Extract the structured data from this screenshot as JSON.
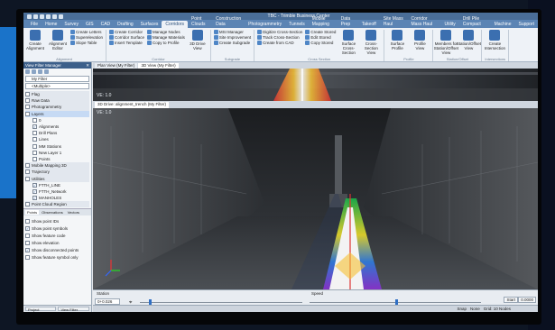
{
  "app": {
    "title": "TBC - Trimble Business Center",
    "menu_tabs": [
      "File",
      "Home",
      "Survey",
      "GIS",
      "CAD",
      "Drafting",
      "Surfaces",
      "Corridors",
      "Point Clouds",
      "Construction Data",
      "Photogrammetry",
      "Tunnels",
      "Mobile Mapping",
      "Data Prep",
      "Takeoff",
      "Site Mass Haul",
      "Corridor Mass Haul",
      "Utility",
      "Drill Pile Compact",
      "Machine",
      "Support"
    ],
    "active_tab": "Corridors"
  },
  "ribbon": {
    "groups": [
      {
        "label": "Alignment",
        "big": [
          "Create Alignment",
          "Alignment Editor"
        ],
        "small": [
          "Create Letters",
          "Superelevation",
          "Slope Table"
        ]
      },
      {
        "label": "Corridor",
        "small": [
          "Create Corridor",
          "Corridor Surface",
          "Insert Template"
        ],
        "small2": [
          "Manage Nodes",
          "Manage Materials",
          "Copy to Profile"
        ],
        "big": [
          "3D Drive View"
        ]
      },
      {
        "label": "Subgrade",
        "small": [
          "MSI Manager",
          "Site Improvement",
          "Create Subgrade"
        ]
      },
      {
        "label": "Cross Section",
        "big": [
          "Surface Cross-Section",
          "Cross-Section View"
        ],
        "small": [
          "Digitize Cross-Section",
          "Track Cross-Section",
          "Create from CAD"
        ],
        "small2": [
          "Create Stored",
          "Edit Stored",
          "Copy Stored"
        ]
      },
      {
        "label": "Profile",
        "big": [
          "Surface Profile",
          "Profile View"
        ]
      },
      {
        "label": "Station/Offset",
        "big": [
          "Members for Station/Offset View",
          "Station/Offset View"
        ]
      },
      {
        "label": "Intersections",
        "big": [
          "Create Intersection"
        ]
      }
    ]
  },
  "left_panel": {
    "title": "View Filter Manager",
    "filter_name": "My Filter",
    "filter_sub": "<Multiple>",
    "groups": [
      {
        "label": "Flag",
        "checked": false
      },
      {
        "label": "Raw Data",
        "checked": false
      },
      {
        "label": "Photogrammetry",
        "checked": false
      }
    ],
    "layers_label": "Layers",
    "layers": [
      {
        "label": "0",
        "checked": false
      },
      {
        "label": "Alignments",
        "checked": true
      },
      {
        "label": "Drill Plans",
        "checked": false
      },
      {
        "label": "Lines",
        "checked": false
      },
      {
        "label": "MM Stations",
        "checked": false
      },
      {
        "label": "New Layer 1",
        "checked": false
      },
      {
        "label": "Points",
        "checked": false
      }
    ],
    "more_groups": [
      {
        "label": "Mobile Mapping 3D",
        "checked": false
      },
      {
        "label": "Trajectory",
        "checked": false
      },
      {
        "label": "Utilities",
        "checked": false
      }
    ],
    "utilities": [
      {
        "label": "FTTH_LINE",
        "checked": true
      },
      {
        "label": "FTTH_Network",
        "checked": true
      },
      {
        "label": "MANHOLES",
        "checked": true
      }
    ],
    "point_cloud_label": "Point Cloud Region",
    "prop_tabs": [
      "Points",
      "Observations",
      "Vectors"
    ],
    "options": [
      {
        "label": "Show point IDs",
        "checked": false
      },
      {
        "label": "Show point symbols",
        "checked": true
      },
      {
        "label": "Show feature code",
        "checked": false
      },
      {
        "label": "Show elevation",
        "checked": false
      },
      {
        "label": "Show disconnected points",
        "checked": true
      },
      {
        "label": "Show feature symbol only",
        "checked": false
      }
    ],
    "bottom_tabs": [
      "Project Explorer",
      "View Filter Ma..."
    ]
  },
  "views": {
    "top_tabs": [
      "Plan View (My Filter)",
      "3D View (My Filter)"
    ],
    "top_label": "VE: 1.0",
    "bottom_tab": "3D Drive: alignment_trench (My Filter)",
    "bottom_label": "VE: 1.0"
  },
  "timeline": {
    "station_label": "Station",
    "station_value": "0+0.026",
    "speed_label": "Speed",
    "start_label": "Start",
    "speed_value": "0.0000",
    "speed_level": 0.5
  },
  "status": {
    "snap": "Snap",
    "none": "None",
    "units": "Grid: 10 Nodes"
  }
}
